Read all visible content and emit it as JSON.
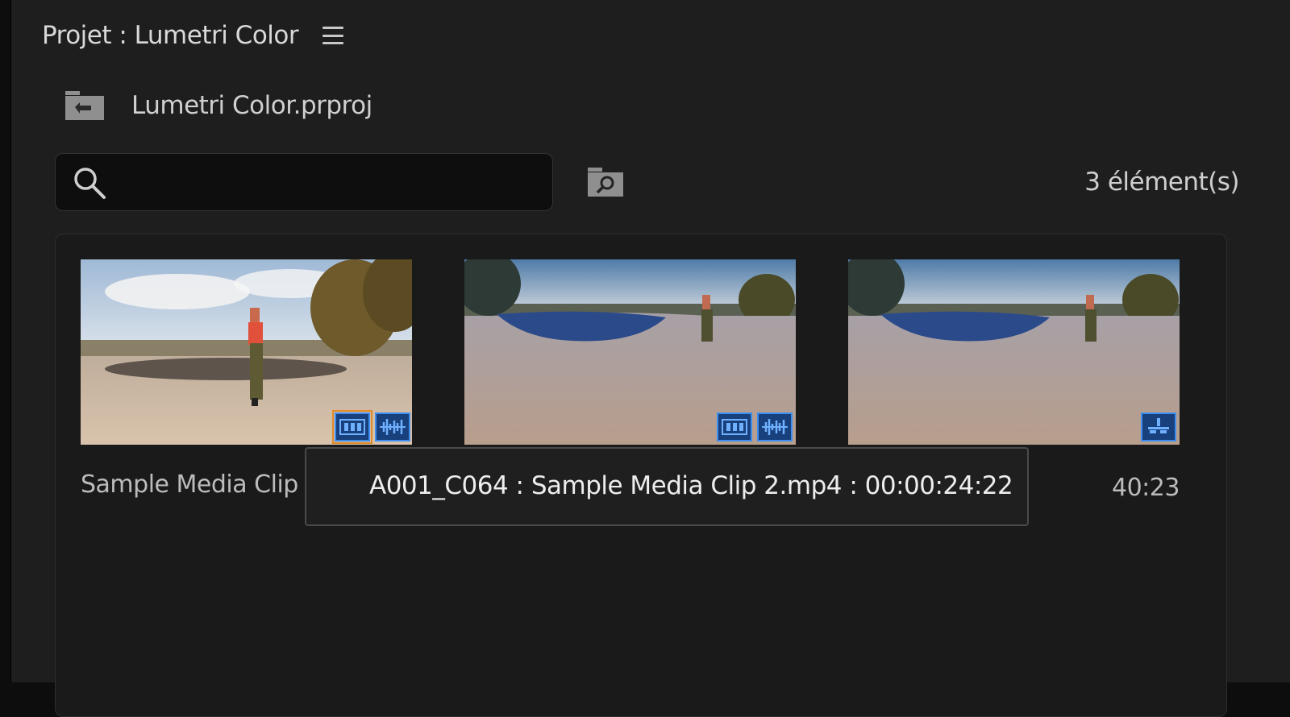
{
  "panel": {
    "title": "Projet : Lumetri Color",
    "menu_icon": "hamburger-menu-icon"
  },
  "bin": {
    "name": "Lumetri Color.prproj",
    "up_icon": "folder-up-icon"
  },
  "search": {
    "value": "",
    "placeholder": "",
    "icon": "search-icon",
    "find_bin_icon": "find-in-bin-icon"
  },
  "item_count": "3 élément(s)",
  "clips": [
    {
      "name": "Sample Media Clip",
      "duration": "",
      "badges": [
        "video-icon",
        "audio-icon"
      ]
    },
    {
      "name": "",
      "duration": "",
      "badges": [
        "video-icon",
        "audio-icon"
      ]
    },
    {
      "name": "",
      "duration": "40:23",
      "badges": [
        "sequence-icon"
      ]
    }
  ],
  "tooltip": {
    "text": "A001_C064 : Sample Media Clip 2.mp4 : 00:00:24:22"
  },
  "colors": {
    "panel_bg": "#1e1e1e",
    "badge_fill": "#18407c",
    "badge_border": "#3e8ef0",
    "focus_ring": "#e08a2a"
  }
}
